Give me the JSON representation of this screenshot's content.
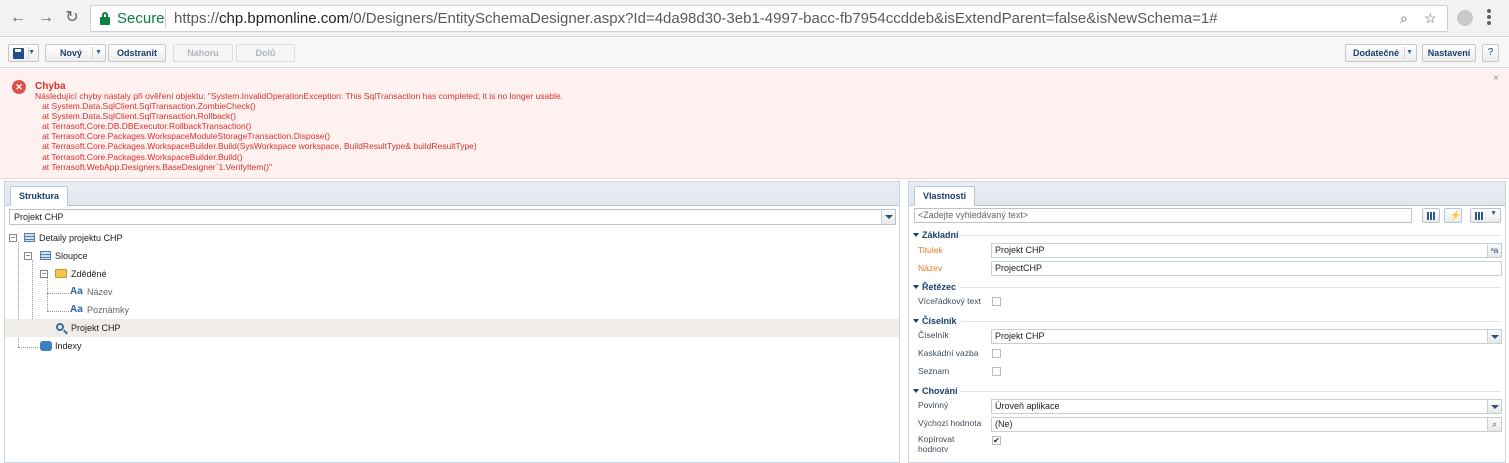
{
  "browser": {
    "secure_label": "Secure",
    "url_scheme": "https://",
    "url_host": "chp.bpmonline.com",
    "url_path": "/0/Designers/EntitySchemaDesigner.aspx?Id=4da98d30-3eb1-4997-bacc-fb7954ccddeb&isExtendParent=false&isNewSchema=1#"
  },
  "toolbar": {
    "new_label": "Nový",
    "delete_label": "Odstranit",
    "up_label": "Nahoru",
    "down_label": "Dolů",
    "additional_label": "Dodatečné",
    "settings_label": "Nastavení",
    "help_label": "?"
  },
  "error": {
    "title": "Chyba",
    "lines": [
      "Následující chyby nastaly při ověření objektu: \"System.InvalidOperationException: This SqlTransaction has completed; it is no longer usable.",
      "   at System.Data.SqlClient.SqlTransaction.ZombieCheck()",
      "   at System.Data.SqlClient.SqlTransaction.Rollback()",
      "   at Terrasoft.Core.DB.DBExecutor.RollbackTransaction()",
      "   at Terrasoft.Core.Packages.WorkspaceModuleStorageTransaction.Dispose()",
      "   at Terrasoft.Core.Packages.WorkspaceBuilder.Build(SysWorkspace workspace, BuildResultType& buildResultType)",
      "   at Terrasoft.Core.Packages.WorkspaceBuilder.Build()",
      "   at Terrasoft.WebApp.Designers.BaseDesigner`1.VerifyItem()\""
    ]
  },
  "structure": {
    "tab_label": "Struktura",
    "selector_value": "Projekt CHP",
    "tree": {
      "root": "Detaily projektu CHP",
      "columns": "Sloupce",
      "inherited": "Zděděné",
      "field_name": "Název",
      "field_notes": "Poznámky",
      "lookup": "Projekt CHP",
      "indexes": "Indexy",
      "field_prefix": "Aa"
    }
  },
  "properties": {
    "tab_label": "Vlastnosti",
    "search_placeholder": "<Zadejte vyhledávaný text>",
    "sections": {
      "basic": "Základní",
      "string": "Řetězec",
      "lookup": "Číselník",
      "behavior": "Chování"
    },
    "fields": {
      "title_label": "Titulek",
      "title_value": "Projekt CHP",
      "name_label": "Název",
      "name_value": "ProjectCHP",
      "multiline_label": "Víceřádkový text",
      "lookup_label": "Číselník",
      "lookup_value": "Projekt CHP",
      "cascade_label": "Kaskádní vazba",
      "list_label": "Seznam",
      "required_label": "Povinný",
      "required_value": "Úroveň aplikace",
      "default_label": "Výchozí hodnota",
      "default_value": "(Ne)",
      "copy_label": "Kopírovat hodnoty",
      "copy_checked": true
    }
  }
}
